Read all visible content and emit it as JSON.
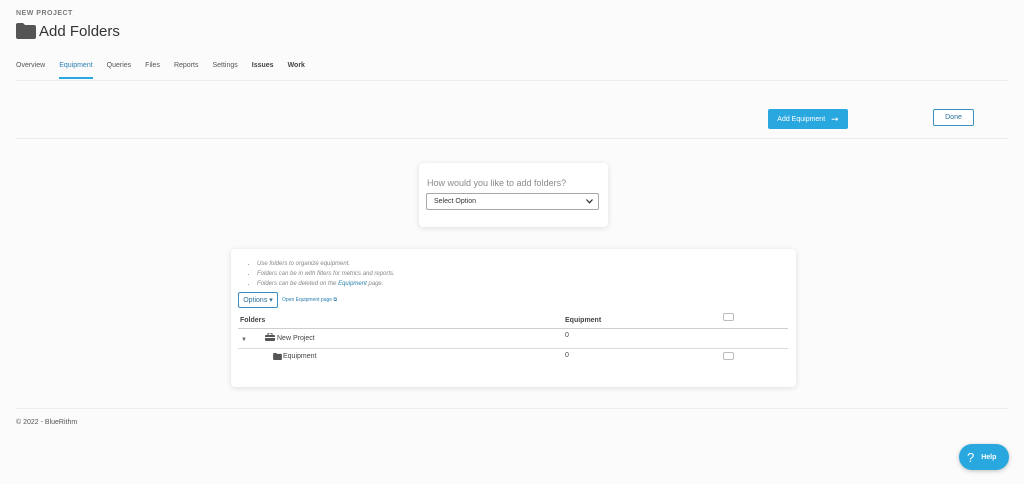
{
  "header": {
    "eyebrow": "NEW PROJECT",
    "title": "Add Folders",
    "icon": "folder-icon"
  },
  "tabs": [
    {
      "label": "Overview"
    },
    {
      "label": "Equipment",
      "active": true
    },
    {
      "label": "Queries"
    },
    {
      "label": "Files"
    },
    {
      "label": "Reports"
    },
    {
      "label": "Settings"
    },
    {
      "label": "Issues"
    },
    {
      "label": "Work"
    }
  ],
  "actions": {
    "add_equipment_label": "Add Equipment",
    "add_equipment_icon": "arrow-right-icon",
    "done_label": "Done"
  },
  "add_folders": {
    "prompt": "How would you like to add folders?",
    "select_value": "Select Option"
  },
  "folders_panel": {
    "tips": [
      "Use folders to organize equipment.",
      "Folders can be in with filters for metrics and reports.",
      "Folders can be deleted on the",
      "Equipment",
      "page."
    ],
    "options_label": "Options",
    "open_link": "Open Equipment page",
    "columns": {
      "folders": "Folders",
      "equipment": "Equipment"
    },
    "rows": [
      {
        "name": "New Project",
        "equipment": "0",
        "icon": "toolbox-icon",
        "expanded": true
      },
      {
        "name": "Equipment",
        "equipment": "0",
        "icon": "folder-icon"
      }
    ]
  },
  "footer": {
    "copyright": "© 2022 - BlueRithm"
  },
  "help": {
    "label": "Help"
  },
  "colors": {
    "accent": "#29a7df",
    "link": "#2a7fb0"
  }
}
